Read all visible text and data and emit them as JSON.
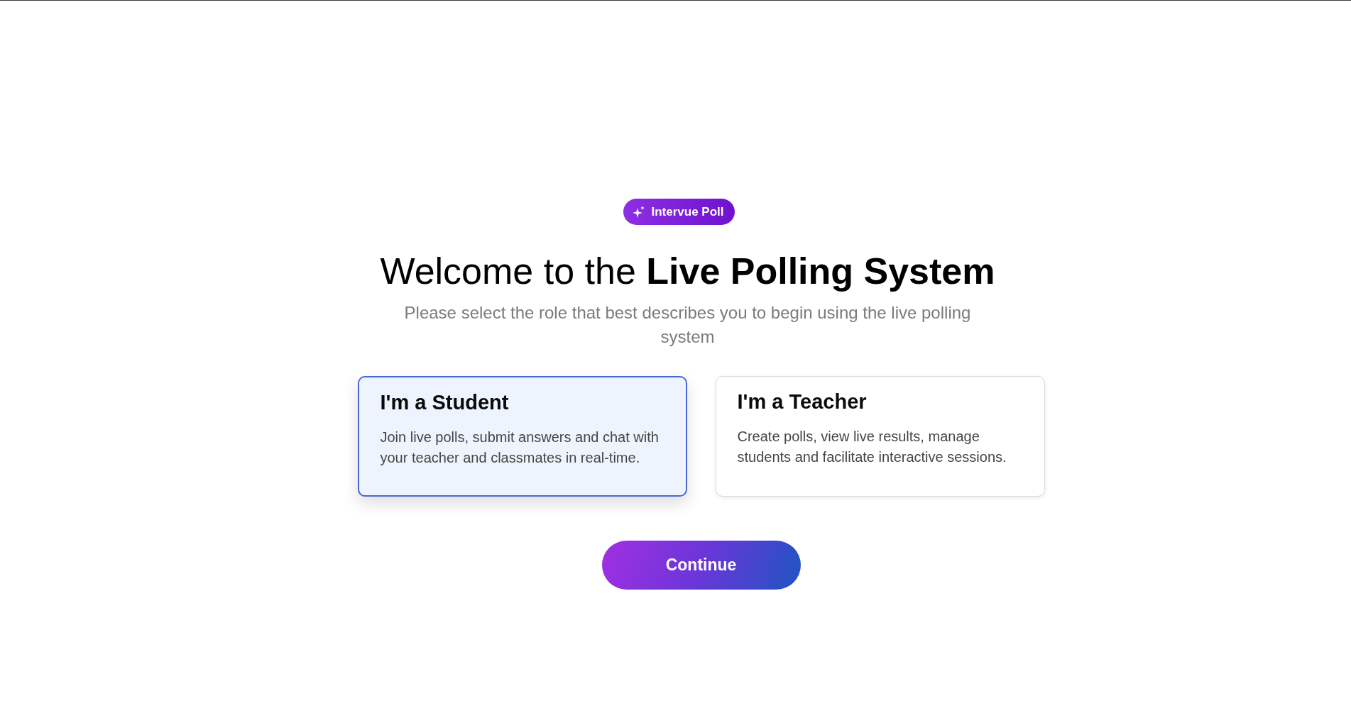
{
  "badge": {
    "label": "Intervue Poll"
  },
  "heading": "Welcome to the **Live Polling System**",
  "subtitle": "Please select the role that best describes you to begin using the live polling system",
  "roles": [
    {
      "title": "I'm a Student",
      "description": "Join live polls, submit answers and chat with your teacher and classmates in real-time.",
      "selected": true
    },
    {
      "title": "I'm a Teacher",
      "description": "Create polls, view live results, manage students and facilitate interactive sessions.",
      "selected": false
    }
  ],
  "continue_button": {
    "label": "Continue"
  }
}
